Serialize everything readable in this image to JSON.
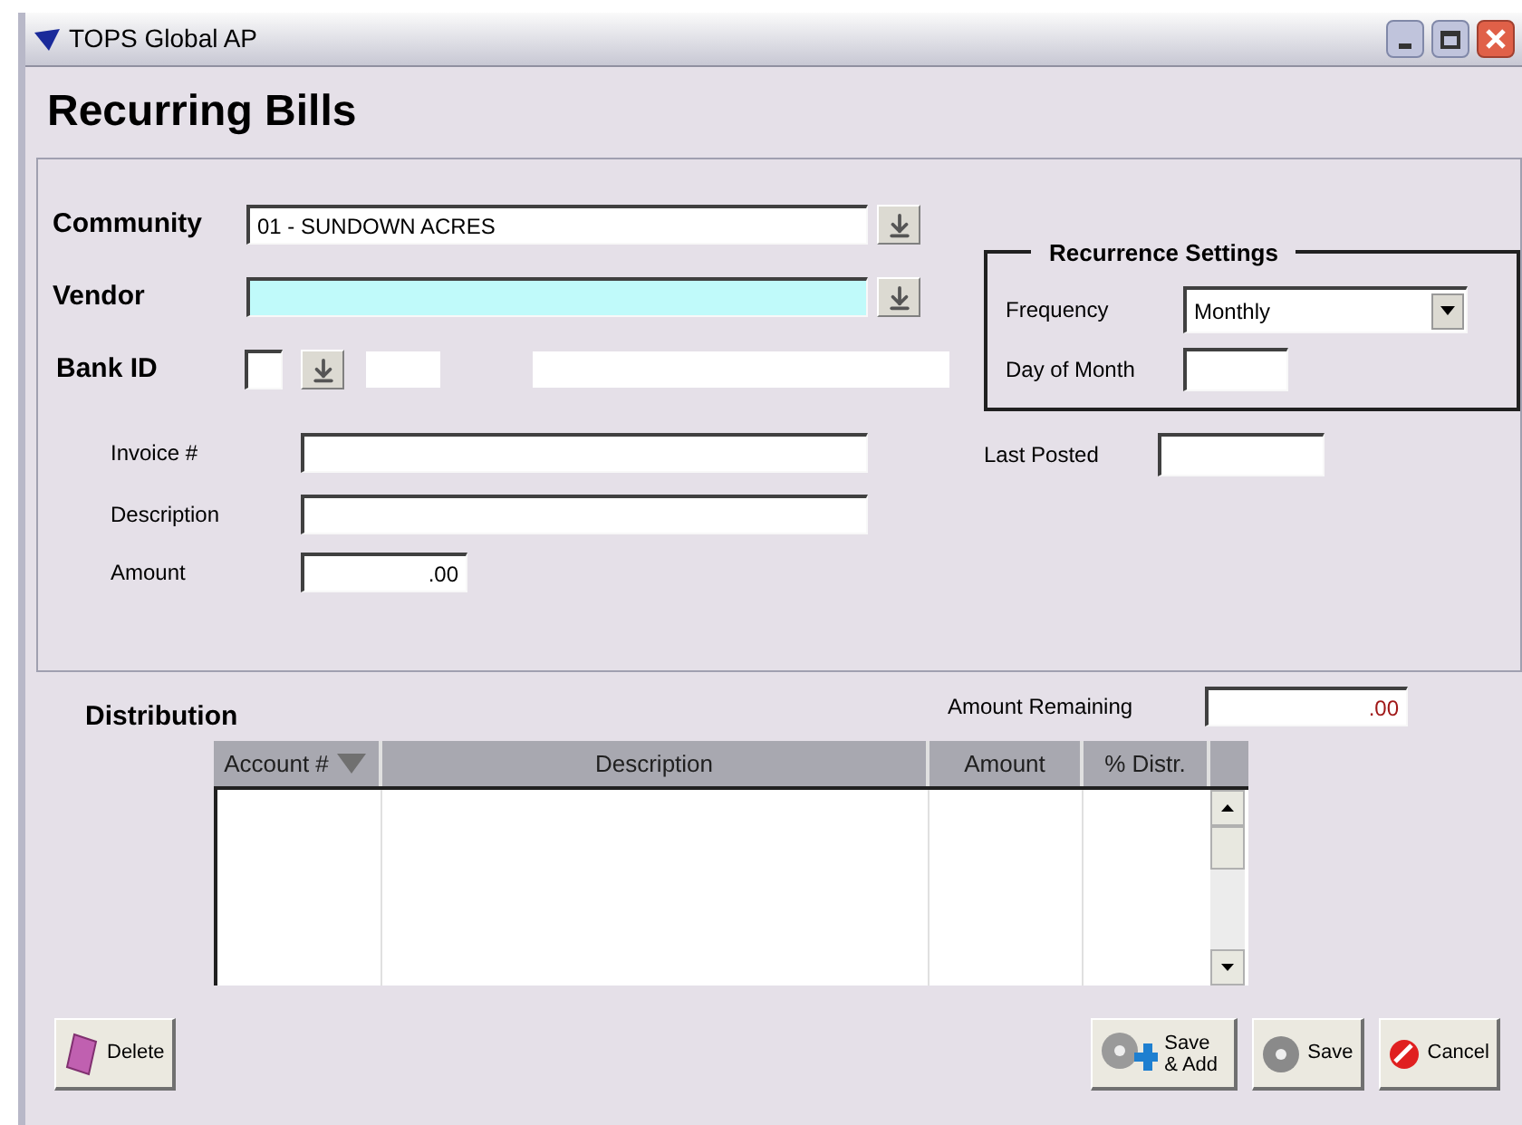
{
  "window": {
    "title": "TOPS Global AP"
  },
  "heading": "Recurring Bills",
  "community": {
    "label": "Community",
    "value": "01  - SUNDOWN ACRES"
  },
  "vendor": {
    "label": "Vendor"
  },
  "bank_id": {
    "label": "Bank ID"
  },
  "invoice": {
    "label": "Invoice #"
  },
  "description": {
    "label": "Description"
  },
  "amount": {
    "label": "Amount",
    "value": ".00"
  },
  "recurrence": {
    "title": "Recurrence Settings",
    "frequency": {
      "label": "Frequency",
      "value": "Monthly"
    },
    "day_of_month": {
      "label": "Day of Month"
    }
  },
  "last_posted": {
    "label": "Last Posted"
  },
  "distribution": {
    "title": "Distribution",
    "amount_remaining": {
      "label": "Amount Remaining",
      "value": ".00"
    },
    "columns": [
      {
        "label": "Account #",
        "sortable": true
      },
      {
        "label": "Description",
        "sortable": false
      },
      {
        "label": "Amount",
        "sortable": false
      },
      {
        "label": "% Distr.",
        "sortable": false
      }
    ]
  },
  "buttons": [
    {
      "label": "Delete",
      "kind": "delete"
    },
    {
      "label": "Save & Add",
      "kind": "save_add"
    },
    {
      "label": "Save",
      "kind": "save"
    },
    {
      "label": "Cancel",
      "kind": "cancel"
    }
  ]
}
